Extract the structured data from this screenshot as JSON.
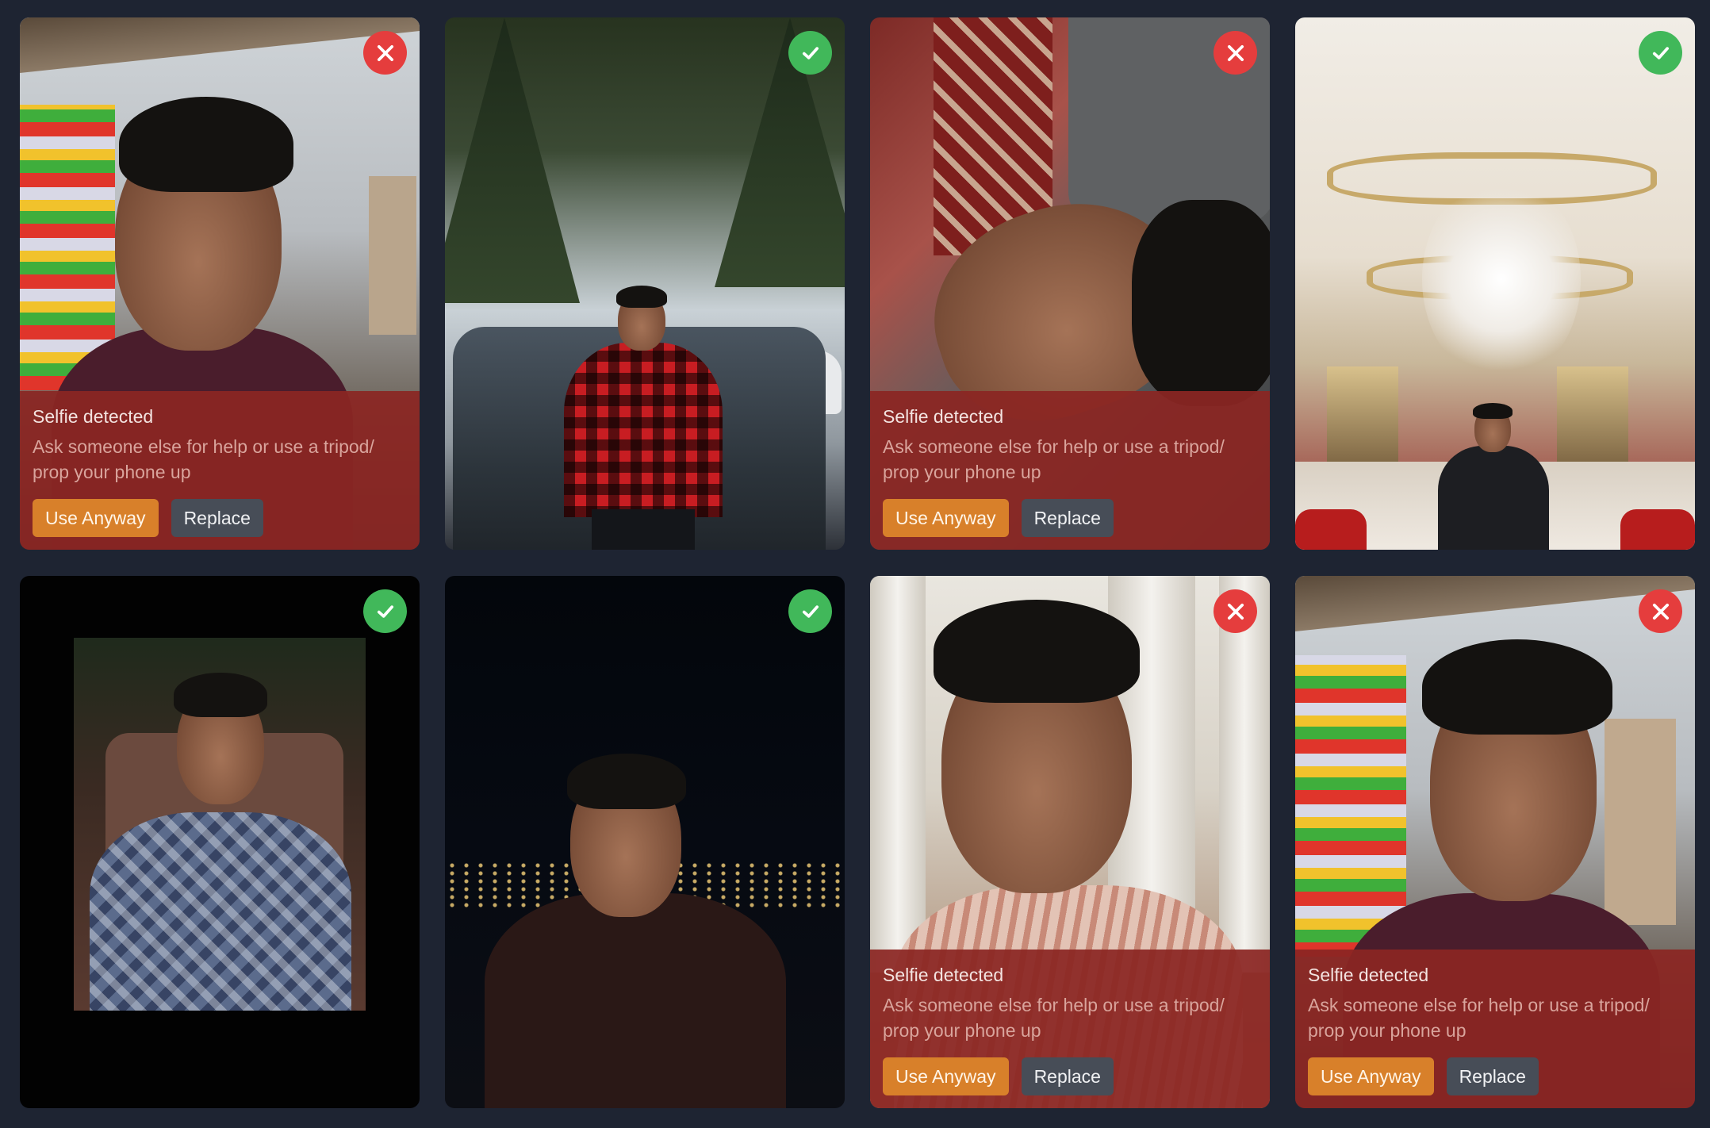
{
  "warning": {
    "title": "Selfie detected",
    "message": "Ask someone else for help or use a tripod/ prop your phone up",
    "use_anyway": "Use Anyway",
    "replace": "Replace"
  },
  "photos": [
    {
      "status": "rejected",
      "status_icon": "close-icon",
      "scene": "shop-selfie"
    },
    {
      "status": "accepted",
      "status_icon": "check-icon",
      "scene": "snow-forest-car"
    },
    {
      "status": "rejected",
      "status_icon": "close-icon",
      "scene": "pillow-selfie"
    },
    {
      "status": "accepted",
      "status_icon": "check-icon",
      "scene": "banquet-hall"
    },
    {
      "status": "accepted",
      "status_icon": "check-icon",
      "scene": "restaurant-portrait"
    },
    {
      "status": "accepted",
      "status_icon": "check-icon",
      "scene": "night-lake"
    },
    {
      "status": "rejected",
      "status_icon": "close-icon",
      "scene": "temple-selfie"
    },
    {
      "status": "rejected",
      "status_icon": "close-icon",
      "scene": "shop-selfie"
    }
  ],
  "colors": {
    "page_background": "#1e2432",
    "reject_badge": "#e53d3d",
    "accept_badge": "#41b85a",
    "warning_panel": "#8b2622",
    "use_anyway_button": "#d8802a",
    "replace_button": "#474d57"
  }
}
